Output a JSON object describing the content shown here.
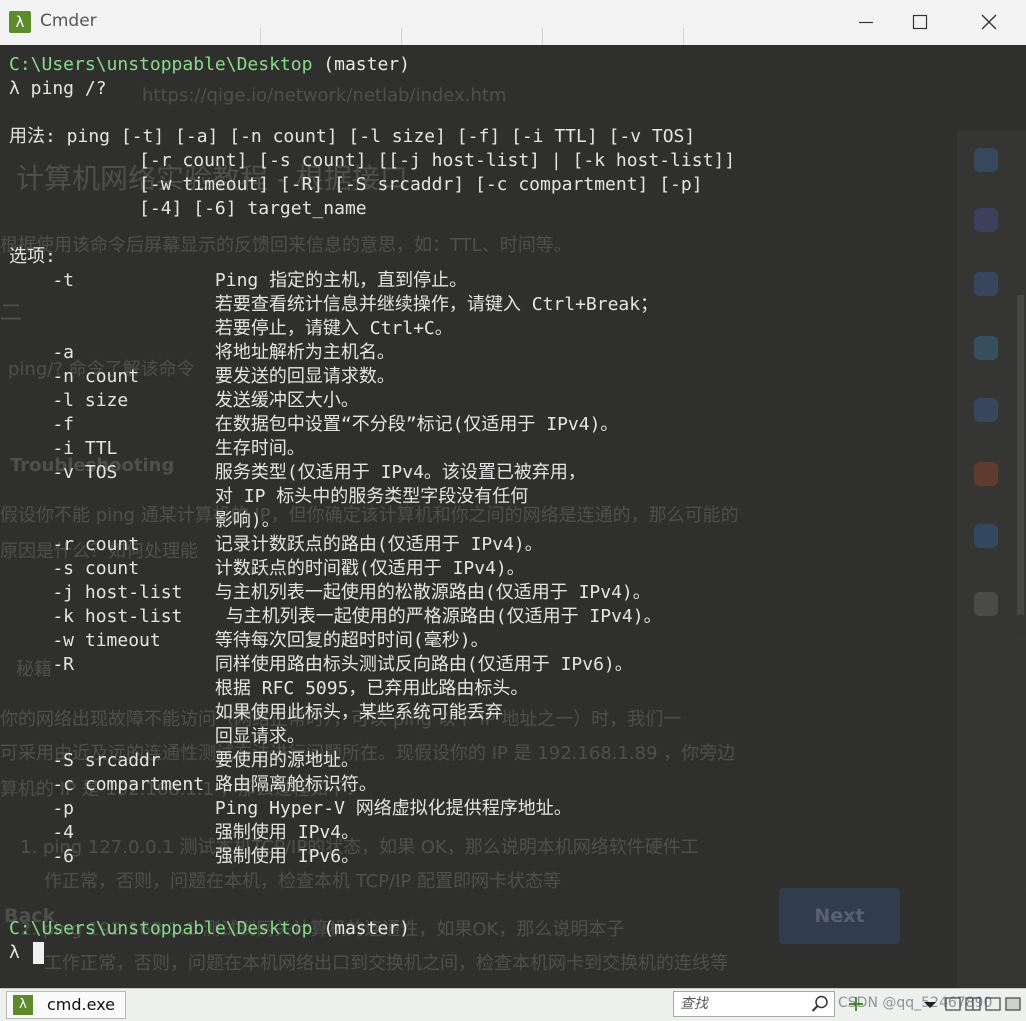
{
  "window": {
    "app_name": "Cmder",
    "app_icon": "λ",
    "controls": [
      "minimize",
      "maximize",
      "close"
    ]
  },
  "background_page": {
    "url": "https://qige.io/network/netlab/index.htm",
    "heading": "计算机网络实验教程 - 根据接口",
    "text_lines": [
      "根据使用该命令后屏幕显示的反馈回来信息的意思，如：TTL、时间等。",
      "二",
      "ping/?  命令了解该命令",
      "Troubleshooting",
      "假设你不能 ping 通某计算机的 IP，但你确定该计算机和你之间的网络是连通的，那么可能的",
      "原因是什么？如何处理能",
      "秘籍",
      "你的网络出现故障不能访问（网络正常时），可以 ping 以下 IP 地址之一）时，我们一",
      "可采用由近及远的连通性测试方法进行问题所在。现假设你的 IP 是 192.168.1.89 ，你旁边",
      "算机的 IP 是 192.168.1.1 ，那么过程如下：",
      "1. ping 127.0.0.1 测试本机TCP/IP的状态，如果 OK，那么说明本机网络软件硬件工",
      "作正常，否则，问题在本机，检查本机 TCP/IP 配置即网卡状态等",
      "Back",
      "2. ping 192.168.1.1 测试到网关计算机的连通性，如果OK，那么说明本子",
      "工作正常，否则，问题在本机网络出口到交换机之间，检查本机网卡到交换机的连线等"
    ],
    "next_button": "Next"
  },
  "terminal": {
    "prompt1_path": "C:\\Users\\unstoppable\\Desktop",
    "prompt1_branch": " (master)",
    "command_line": "λ ping /?",
    "output_lines": [
      "",
      "用法: ping [-t] [-a] [-n count] [-l size] [-f] [-i TTL] [-v TOS]",
      "            [-r count] [-s count] [[-j host-list] | [-k host-list]]",
      "            [-w timeout] [-R] [-S srcaddr] [-c compartment] [-p]",
      "            [-4] [-6] target_name",
      "",
      "选项:",
      "    -t             Ping 指定的主机，直到停止。",
      "                   若要查看统计信息并继续操作，请键入 Ctrl+Break；",
      "                   若要停止，请键入 Ctrl+C。",
      "    -a             将地址解析为主机名。",
      "    -n count       要发送的回显请求数。",
      "    -l size        发送缓冲区大小。",
      "    -f             在数据包中设置“不分段”标记(仅适用于 IPv4)。",
      "    -i TTL         生存时间。",
      "    -v TOS         服务类型(仅适用于 IPv4。该设置已被弃用，",
      "                   对 IP 标头中的服务类型字段没有任何",
      "                   影响)。",
      "    -r count       记录计数跃点的路由(仅适用于 IPv4)。",
      "    -s count       计数跃点的时间戳(仅适用于 IPv4)。",
      "    -j host-list   与主机列表一起使用的松散源路由(仅适用于 IPv4)。",
      "    -k host-list    与主机列表一起使用的严格源路由(仅适用于 IPv4)。",
      "    -w timeout     等待每次回复的超时时间(毫秒)。",
      "    -R             同样使用路由标头测试反向路由(仅适用于 IPv6)。",
      "                   根据 RFC 5095，已弃用此路由标头。",
      "                   如果使用此标头，某些系统可能丢弃",
      "                   回显请求。",
      "    -S srcaddr     要使用的源地址。",
      "    -c compartment 路由隔离舱标识符。",
      "    -p             Ping Hyper-V 网络虚拟化提供程序地址。",
      "    -4             强制使用 IPv4。",
      "    -6             强制使用 IPv6。",
      "",
      ""
    ],
    "prompt2_path": "C:\\Users\\unstoppable\\Desktop",
    "prompt2_branch": " (master)",
    "input_prompt": "λ "
  },
  "statusbar": {
    "tab_label": "cmd.exe",
    "tab_icon": "λ",
    "search_placeholder": "查找",
    "watermark": "CSDN @qq_52467890"
  }
}
